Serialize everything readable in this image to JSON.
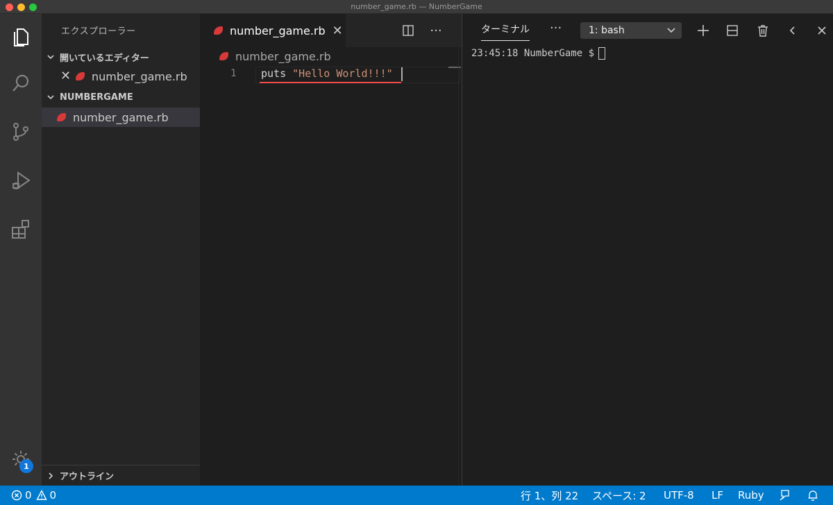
{
  "window": {
    "title": "number_game.rb — NumberGame"
  },
  "activity_bar": {
    "icons": [
      "explorer-icon",
      "search-icon",
      "source-control-icon",
      "run-debug-icon",
      "extensions-icon",
      "manage-gear-icon"
    ],
    "badge_count": "1"
  },
  "sidebar": {
    "title": "エクスプローラー",
    "open_editors": {
      "label": "開いているエディター",
      "files": [
        {
          "name": "number_game.rb"
        }
      ]
    },
    "project": {
      "label": "NUMBERGAME",
      "files": [
        {
          "name": "number_game.rb"
        }
      ]
    },
    "outline_label": "アウトライン"
  },
  "editor": {
    "tab": {
      "label": "number_game.rb"
    },
    "breadcrumb": "number_game.rb",
    "lines": [
      {
        "number": "1",
        "keyword": "puts",
        "string": "\"Hello World!!!\""
      }
    ]
  },
  "panel": {
    "tab_label": "ターミナル",
    "terminal_select": "1: bash",
    "prompt": "23:45:18 NumberGame $"
  },
  "status": {
    "errors": "0",
    "warnings": "0",
    "position": "行 1、列 22",
    "spaces": "スペース: 2",
    "encoding": "UTF-8",
    "eol": "LF",
    "language": "Ruby"
  },
  "colors": {
    "status_bar": "#007acc",
    "accent": "#1177dd",
    "ruby_icon": "#d83a3a",
    "string": "#ce9178",
    "error_squiggle": "#f14c4c"
  }
}
